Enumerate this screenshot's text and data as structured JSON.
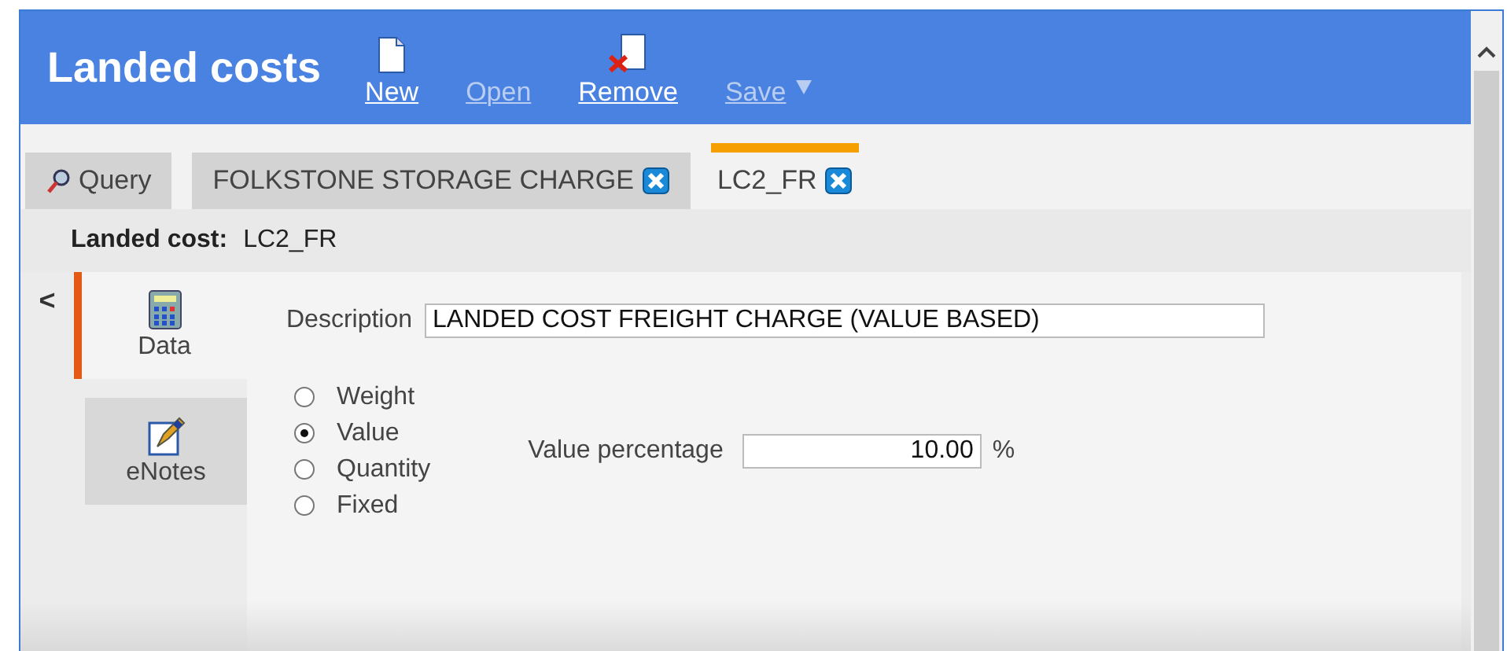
{
  "window": {
    "title": "Landed costs"
  },
  "toolbar": [
    {
      "label": "New",
      "kind": "new",
      "disabled": false
    },
    {
      "label": "Open",
      "kind": "open",
      "disabled": true
    },
    {
      "label": "Remove",
      "kind": "remove",
      "disabled": false
    },
    {
      "label": "Save",
      "kind": "save",
      "disabled": true
    }
  ],
  "tabs": [
    {
      "label": "Query",
      "kind": "query",
      "selected": false
    },
    {
      "label": "FOLKSTONE STORAGE CHARGE",
      "kind": "record",
      "selected": false
    },
    {
      "label": "LC2_FR",
      "kind": "record",
      "selected": true
    }
  ],
  "record_header": {
    "label": "Landed cost:",
    "value": "LC2_FR"
  },
  "collapse_button": "<",
  "side_tabs": [
    {
      "label": "Data",
      "kind": "data",
      "selected": true
    },
    {
      "label": "eNotes",
      "kind": "notes",
      "selected": false
    }
  ],
  "description": {
    "label": "Description",
    "value": "LANDED COST FREIGHT CHARGE (VALUE BASED)"
  },
  "basis_options": [
    {
      "label": "Weight",
      "selected": false
    },
    {
      "label": "Value",
      "selected": true
    },
    {
      "label": "Quantity",
      "selected": false
    },
    {
      "label": "Fixed",
      "selected": false
    }
  ],
  "value_percentage": {
    "label": "Value percentage",
    "value": "10.00",
    "unit": "%"
  }
}
